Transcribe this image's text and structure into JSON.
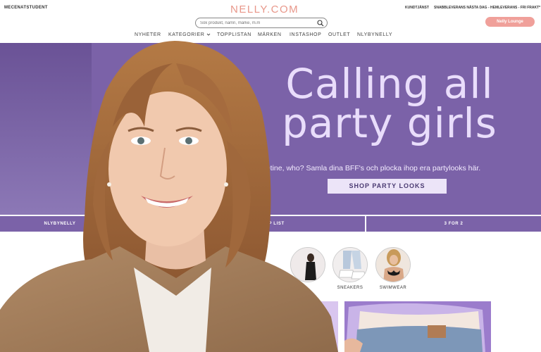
{
  "header": {
    "mecenat": "MECENATSTUDENT",
    "logo": "NELLY.COM",
    "kundtjanst": "KUNDTJÄNST",
    "shipping": "SNABBLEVERANS NÄSTA DAG - HEMLEVERANS - FRI FRAKT*",
    "lounge_label": "Nelly Lounge"
  },
  "search": {
    "placeholder": "Sök produkt, namn, märke, m.m",
    "icon": "search-icon"
  },
  "nav": {
    "items": [
      {
        "label": "NYHETER"
      },
      {
        "label": "KATEGORIER"
      },
      {
        "label": "TOPPLISTAN"
      },
      {
        "label": "MÄRKEN"
      },
      {
        "label": "INSTASHOP"
      },
      {
        "label": "OUTLET"
      },
      {
        "label": "NLYBYNELLY"
      }
    ]
  },
  "hero": {
    "title_line1": "Calling all",
    "title_line2": "party girls",
    "subtitle": "entine, who? Samla dina BFF's och plocka ihop era partylooks här.",
    "cta": "SHOP PARTY LOOKS"
  },
  "category_bar": {
    "items": [
      {
        "label": "NLYBYNELLY"
      },
      {
        "label": "OP LIST"
      },
      {
        "label": "3 FOR 2"
      }
    ]
  },
  "circles": [
    {
      "label": ""
    },
    {
      "label": "SNEAKERS"
    },
    {
      "label": "SWIMWEAR"
    }
  ],
  "colors": {
    "brand_pink": "#e8978a",
    "hero_purple": "#7b62a8",
    "lounge_button": "#f0a09a"
  }
}
